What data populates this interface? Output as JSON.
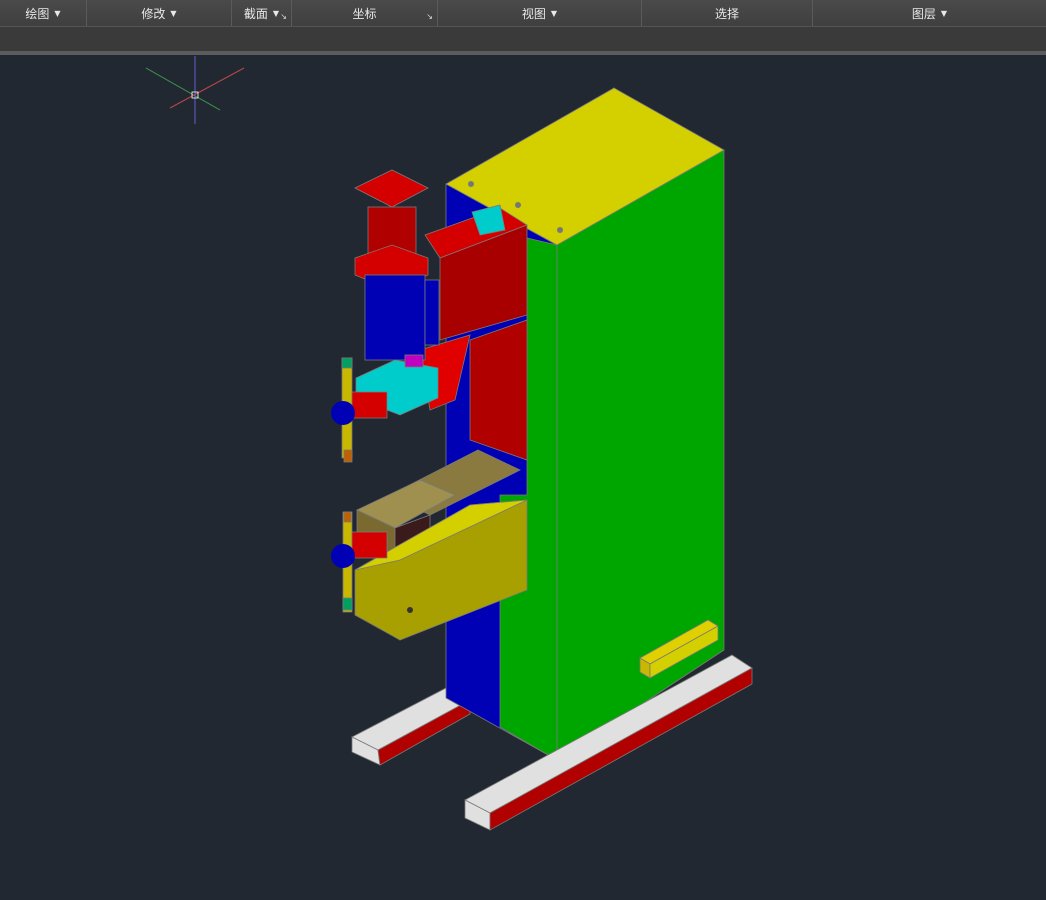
{
  "ribbon": {
    "panels": [
      {
        "label": "绘图",
        "dropdown": true
      },
      {
        "label": "修改",
        "dropdown": true
      },
      {
        "label": "截面",
        "dropdown": true,
        "launcher": true
      },
      {
        "label": "坐标",
        "dropdown": false,
        "launcher": true
      },
      {
        "label": "视图",
        "dropdown": true
      },
      {
        "label": "选择",
        "dropdown": false
      },
      {
        "label": "图层",
        "dropdown": true
      }
    ]
  },
  "viewport": {
    "background": "#222831",
    "colors": {
      "yellow": "#d4d000",
      "green": "#00a600",
      "blue": "#0000b4",
      "red": "#d40000",
      "cyan": "#00cccc",
      "darkred": "#a80000"
    }
  }
}
